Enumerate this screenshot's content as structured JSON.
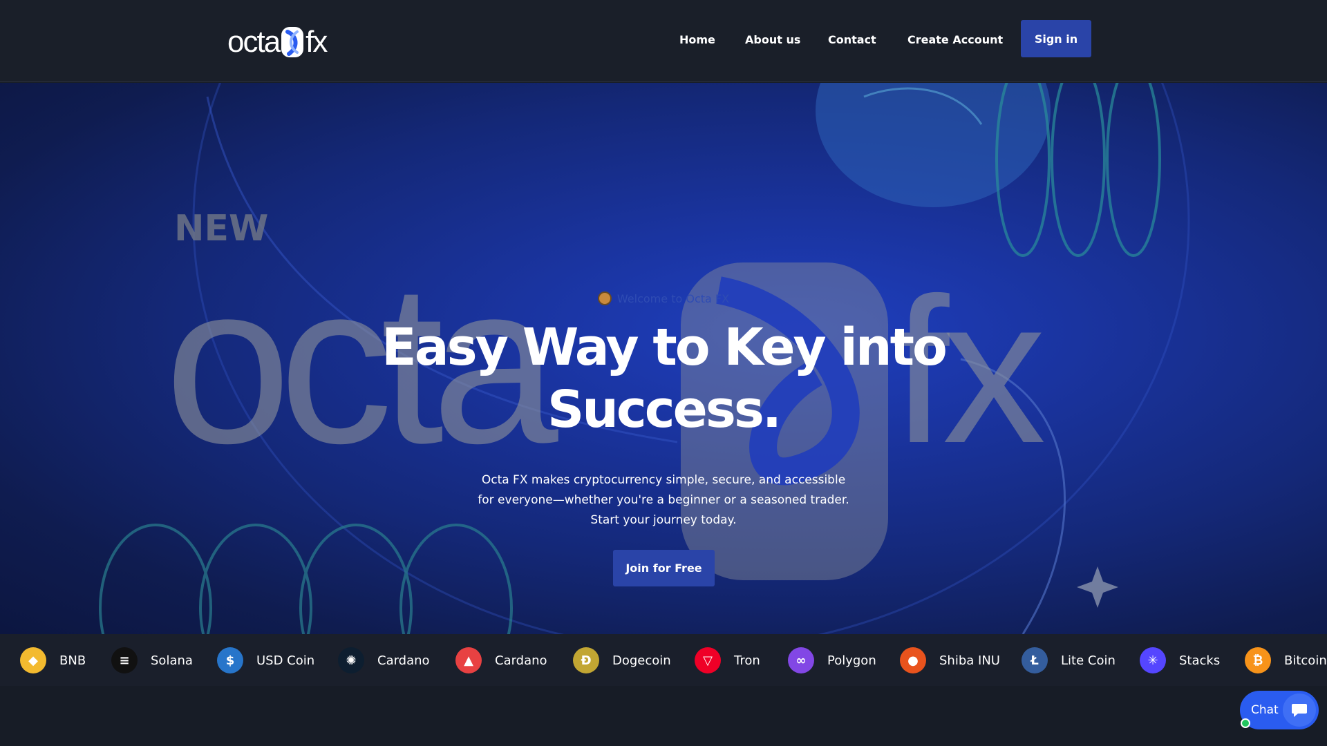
{
  "brand": {
    "logo_left": "octa",
    "logo_right": "fx"
  },
  "nav": {
    "links": [
      "Home",
      "About us",
      "Contact",
      "Create Account"
    ],
    "signin_label": "Sign in"
  },
  "hero": {
    "welcome": "Welcome to Octa FX",
    "headline_line1": "Easy Way to Key into",
    "headline_line2": "Success.",
    "sub_line1": "Octa FX makes cryptocurrency simple, secure, and accessible",
    "sub_line2": "for everyone—whether you're a beginner or a seasoned trader.",
    "sub_line3": "Start your journey today.",
    "cta_label": "Join for Free",
    "bg_new": "NEW",
    "bg_octa": "octa",
    "bg_fx": "fx"
  },
  "ticker": [
    {
      "label": "BNB",
      "icon": "bnb-icon",
      "color": "#f3ba2f"
    },
    {
      "label": "Solana",
      "icon": "solana-icon",
      "color": "#111111"
    },
    {
      "label": "USD Coin",
      "icon": "usdc-icon",
      "color": "#2775ca"
    },
    {
      "label": "Cardano",
      "icon": "cardano-icon",
      "color": "#0d1e30"
    },
    {
      "label": "Cardano",
      "icon": "avalanche-icon",
      "color": "#e84142"
    },
    {
      "label": "Dogecoin",
      "icon": "dogecoin-icon",
      "color": "#c2a633"
    },
    {
      "label": "Tron",
      "icon": "tron-icon",
      "color": "#ef0027"
    },
    {
      "label": "Polygon",
      "icon": "polygon-icon",
      "color": "#8247e5"
    },
    {
      "label": "Shiba INU",
      "icon": "shiba-icon",
      "color": "#e9531d"
    },
    {
      "label": "Lite Coin",
      "icon": "litecoin-icon",
      "color": "#345d9d"
    },
    {
      "label": "Stacks",
      "icon": "stacks-icon",
      "color": "#5546ff"
    },
    {
      "label": "Bitcoin",
      "icon": "bitcoin-icon",
      "color": "#f7931a"
    }
  ],
  "chat": {
    "label": "Chat"
  }
}
